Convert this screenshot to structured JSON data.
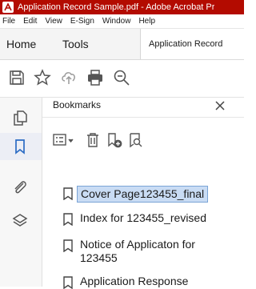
{
  "window": {
    "title": "Application Record Sample.pdf - Adobe Acrobat Pr"
  },
  "menu": [
    "File",
    "Edit",
    "View",
    "E-Sign",
    "Window",
    "Help"
  ],
  "tabs": {
    "home": "Home",
    "tools": "Tools",
    "document": "Application Record"
  },
  "toolbar": {
    "icons": [
      "save-icon",
      "star-icon",
      "cloud-upload-icon",
      "print-icon",
      "zoom-out-icon"
    ]
  },
  "leftrail": {
    "icons": [
      "pages-icon",
      "bookmark-icon",
      "attachment-icon",
      "layers-icon"
    ],
    "active": "bookmark-icon"
  },
  "bookmarks_panel": {
    "title": "Bookmarks",
    "tools": [
      "options-icon",
      "delete-icon",
      "new-bookmark-icon",
      "expand-bookmark-icon"
    ],
    "items": [
      {
        "label": "Cover Page123455_final",
        "selected": true
      },
      {
        "label": "Index for 123455_revised",
        "selected": false
      },
      {
        "label": "Notice of Applicaton for 123455",
        "selected": false
      },
      {
        "label": "Application Response",
        "selected": false
      }
    ]
  },
  "colors": {
    "titlebar": "#b30b00",
    "selection_bg": "#c9dcf4",
    "selection_border": "#7aa4d6",
    "active_rail": "#2b6cc4"
  }
}
